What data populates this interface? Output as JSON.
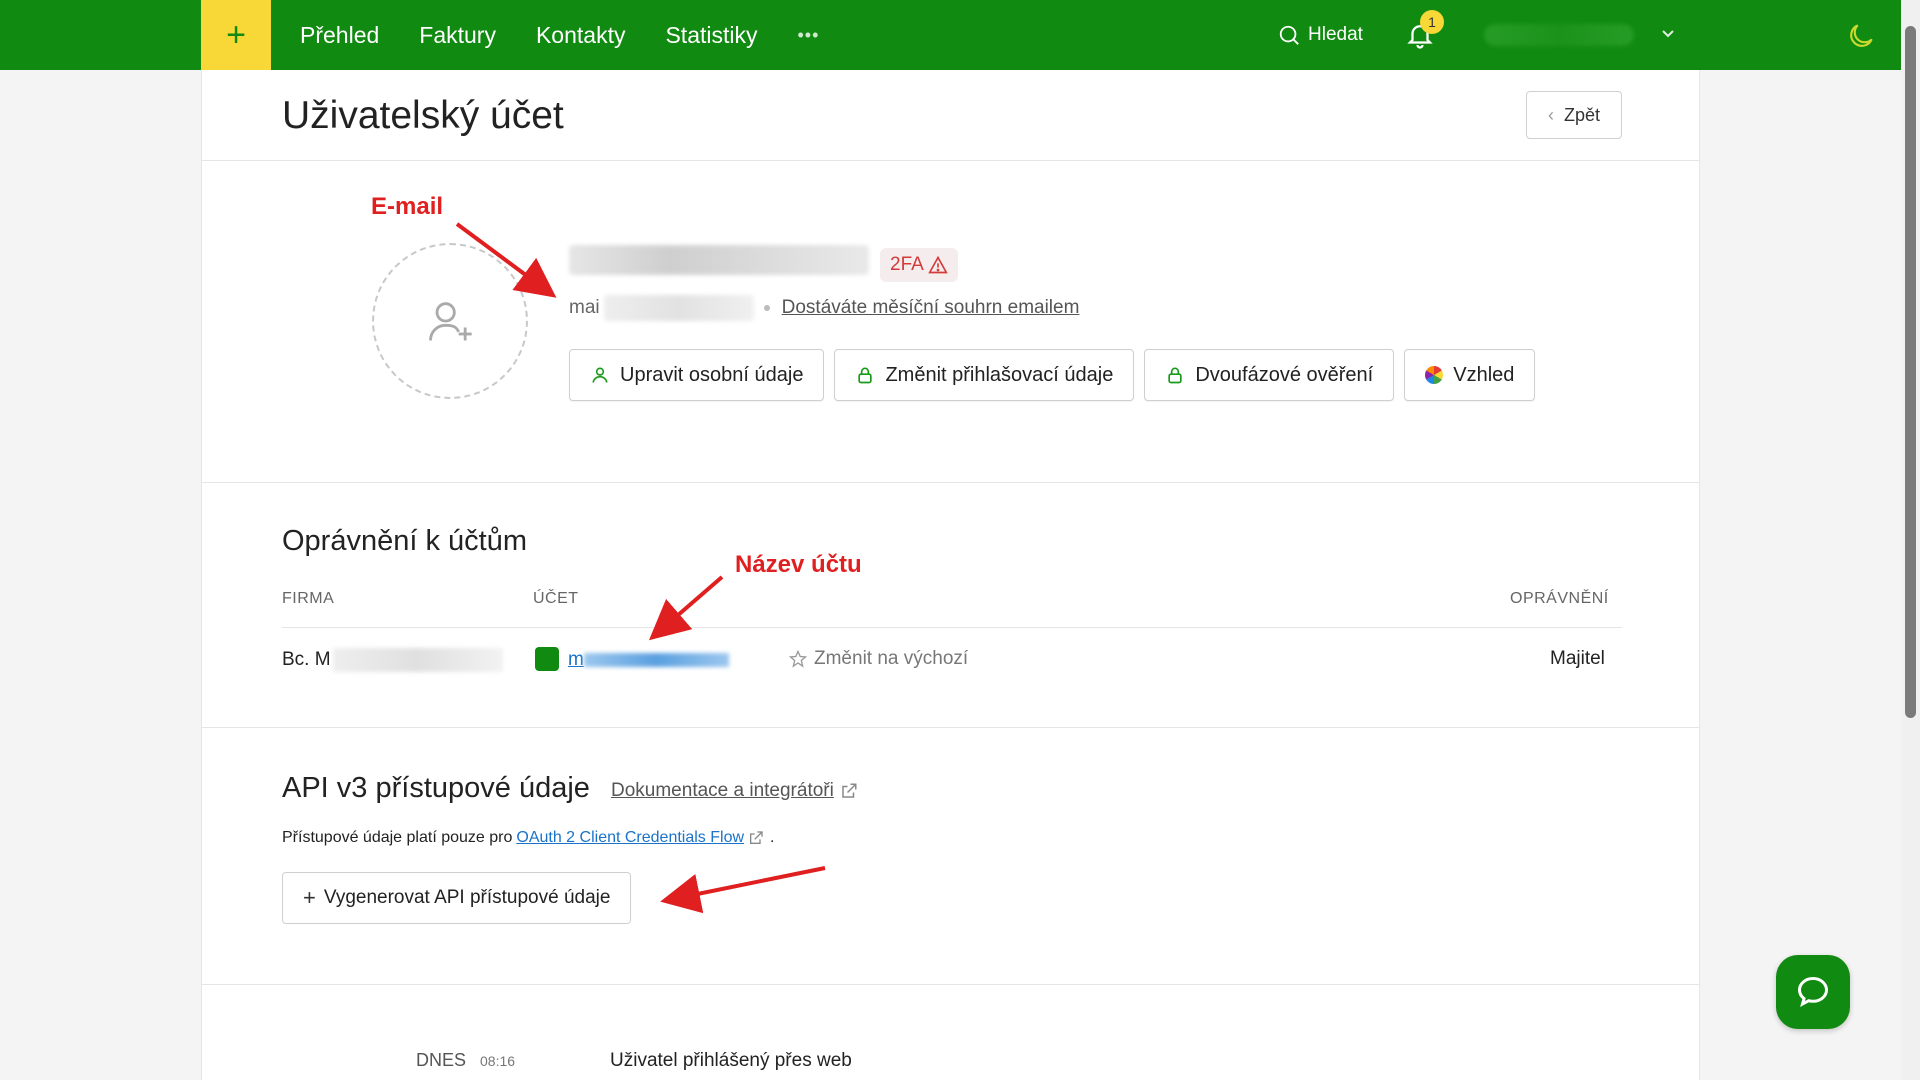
{
  "topbar": {
    "nav": [
      "Přehled",
      "Faktury",
      "Kontakty",
      "Statistiky"
    ],
    "more": "•••",
    "search_label": "Hledat",
    "notification_count": "1",
    "colors": {
      "bar": "#108a10",
      "accent": "#f7d836"
    }
  },
  "page": {
    "title": "Uživatelský účet",
    "back_label": "Zpět"
  },
  "profile": {
    "tfa_badge": "2FA",
    "email_prefix": "mai",
    "monthly_summary_link": "Dostáváte měsíční souhrn emailem",
    "buttons": {
      "edit_personal": "Upravit osobní údaje",
      "change_login": "Změnit přihlašovací údaje",
      "two_factor": "Dvoufázové ověření",
      "appearance": "Vzhled"
    }
  },
  "annotations": {
    "email": "E-mail",
    "account_name": "Název účtu"
  },
  "permissions": {
    "title": "Oprávnění k účtům",
    "headers": {
      "company": "FIRMA",
      "account": "ÚČET",
      "permission": "OPRÁVNĚNÍ"
    },
    "row": {
      "company_prefix": "Bc. M",
      "account_prefix": "m",
      "make_default": "Změnit na výchozí",
      "role": "Majitel"
    }
  },
  "api": {
    "title": "API v3 přístupové údaje",
    "docs_link": "Dokumentace a integrátoři",
    "note_prefix": "Přístupové údaje platí pouze pro",
    "note_link": "OAuth 2 Client Credentials Flow",
    "note_suffix": ".",
    "generate_button": "Vygenerovat API přístupové údaje"
  },
  "activity": {
    "day": "DNES",
    "time": "08:16",
    "text": "Uživatel přihlášený přes web"
  }
}
